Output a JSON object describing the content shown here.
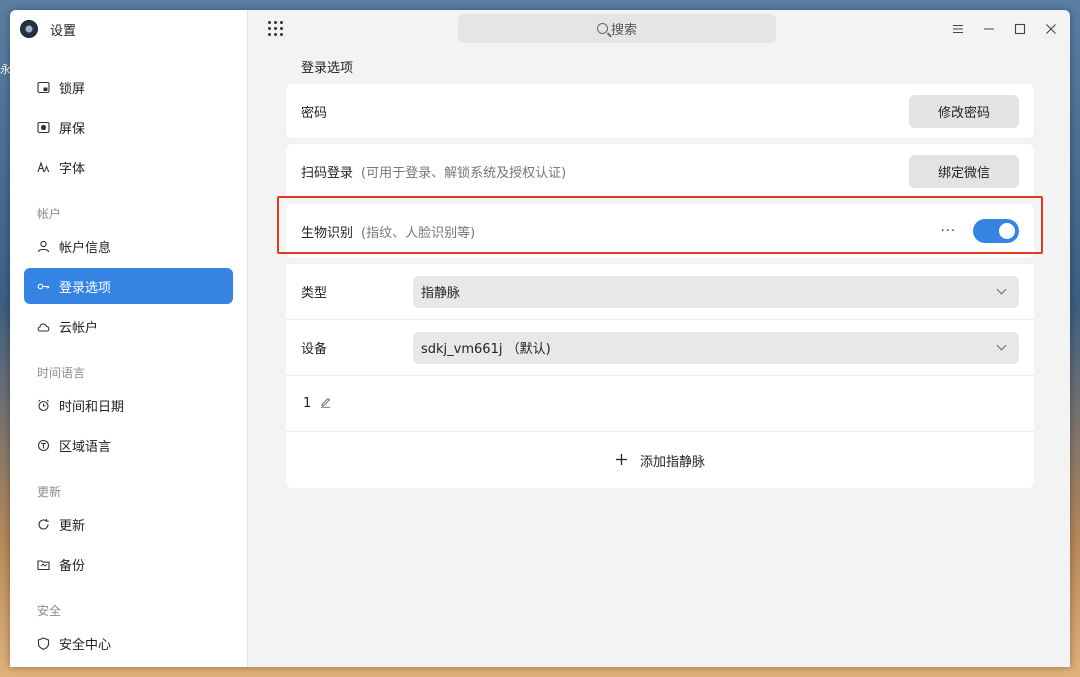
{
  "app": {
    "title": "设置"
  },
  "background": {
    "peek_text": "永"
  },
  "sidebar": {
    "items_top": [
      {
        "label": "锁屏",
        "icon": "lockscreen-icon"
      },
      {
        "label": "屏保",
        "icon": "screensaver-icon"
      },
      {
        "label": "字体",
        "icon": "font-icon"
      }
    ],
    "groups": [
      {
        "title": "帐户",
        "items": [
          {
            "label": "帐户信息",
            "icon": "user-icon"
          },
          {
            "label": "登录选项",
            "icon": "key-icon",
            "active": true
          },
          {
            "label": "云帐户",
            "icon": "cloud-icon"
          }
        ]
      },
      {
        "title": "时间语言",
        "items": [
          {
            "label": "时间和日期",
            "icon": "alarm-clock-icon"
          },
          {
            "label": "区域语言",
            "icon": "region-icon"
          }
        ]
      },
      {
        "title": "更新",
        "items": [
          {
            "label": "更新",
            "icon": "refresh-icon"
          },
          {
            "label": "备份",
            "icon": "backup-icon"
          }
        ]
      },
      {
        "title": "安全",
        "items": [
          {
            "label": "安全中心",
            "icon": "shield-icon"
          }
        ]
      }
    ]
  },
  "topbar": {
    "search_placeholder": "搜索"
  },
  "main": {
    "section_title": "登录选项",
    "password": {
      "label": "密码",
      "button": "修改密码"
    },
    "qrcode": {
      "label": "扫码登录",
      "hint": "(可用于登录、解锁系统及授权认证)",
      "button": "绑定微信"
    },
    "biometric": {
      "label": "生物识别",
      "hint": "(指纹、人脸识别等)",
      "more": "···",
      "enabled": true
    },
    "type": {
      "label": "类型",
      "value": "指静脉"
    },
    "device": {
      "label": "设备",
      "value": "sdkj_vm661j （默认)"
    },
    "enrolled": {
      "item": "1"
    },
    "add": {
      "label": "添加指静脉"
    }
  },
  "colors": {
    "accent": "#3584e4",
    "highlight": "#e03b1f",
    "window_bg": "#f3f3f3"
  }
}
